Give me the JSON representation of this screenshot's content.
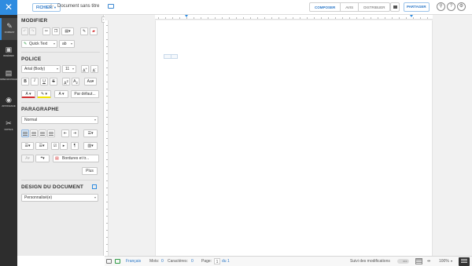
{
  "topbar": {
    "file_label": "FICHIER",
    "doc_title": "Document sans titre",
    "modes": [
      "COMPOSER",
      "AVIS",
      "DISTRIBUER"
    ],
    "active_mode": "COMPOSER",
    "share_label": "PARTAGER"
  },
  "rail": {
    "items": [
      {
        "label": "FORMAT",
        "icon": "format-brush-icon"
      },
      {
        "label": "INSÉRER",
        "icon": "insert-image-icon"
      },
      {
        "label": "MISE EN PAGE",
        "icon": "page-layout-icon"
      },
      {
        "label": "AFFICHAGE",
        "icon": "eye-icon"
      },
      {
        "label": "OUTILS",
        "icon": "tools-icon"
      }
    ]
  },
  "panel": {
    "modifier_title": "MODIFIER",
    "quick_text": "Quick Text",
    "police_title": "POLICE",
    "font_family": "Arial (Body)",
    "font_size": "11",
    "default_btn": "Par défaut...",
    "paragraphe_title": "PARAGRAPHE",
    "paragraph_style": "Normal",
    "borders_btn": "Bordures et tr...",
    "plus_btn": "Plus",
    "design_title": "DESIGN DU DOCUMENT",
    "design_value": "Personnalisé(e)"
  },
  "status": {
    "language": "Français",
    "words_label": "Mots:",
    "words_value": "0",
    "chars_label": "Caractères:",
    "chars_value": "0",
    "page_label": "Page:",
    "page_value": "1",
    "page_of": "du 1",
    "track_changes": "Suivi des modifications",
    "toggle_state": "OFF",
    "zoom": "100%"
  },
  "colors": {
    "accent": "#2f8ce0",
    "rail_bg": "#2d2d2d",
    "panel_bg": "#ebebeb",
    "font_color_swatch": "#d32f2f",
    "highlight_swatch": "#f2e300"
  }
}
